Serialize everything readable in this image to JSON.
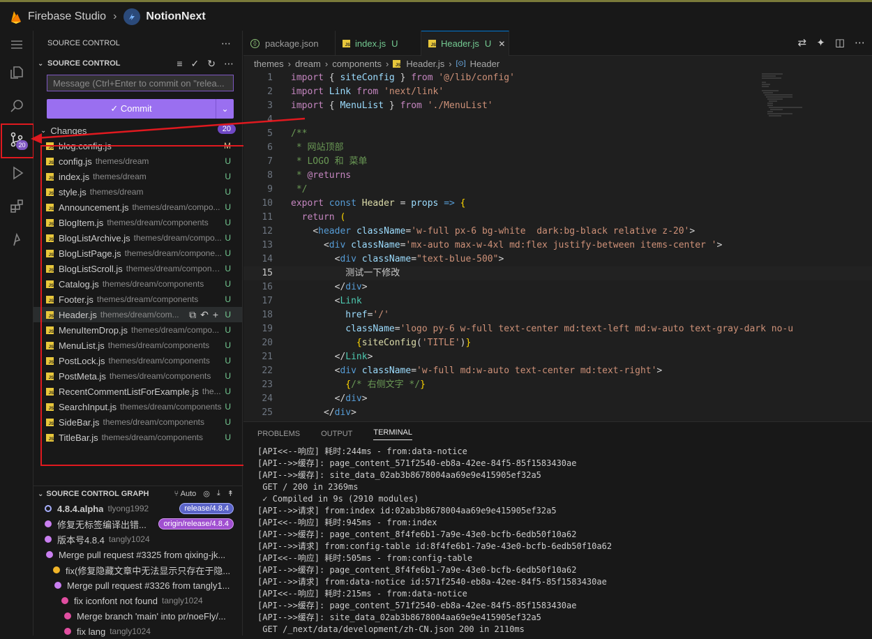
{
  "app": {
    "name": "Firebase Studio",
    "project": "NotionNext"
  },
  "sidebar": {
    "title": "SOURCE CONTROL",
    "section": "SOURCE CONTROL",
    "commit_placeholder": "Message (Ctrl+Enter to commit on \"relea...",
    "commit_label": "Commit",
    "changes_label": "Changes",
    "changes_count": "20",
    "badge_count": "20",
    "files": [
      {
        "name": "blog.config.js",
        "path": "",
        "status": "M"
      },
      {
        "name": "config.js",
        "path": "themes/dream",
        "status": "U"
      },
      {
        "name": "index.js",
        "path": "themes/dream",
        "status": "U"
      },
      {
        "name": "style.js",
        "path": "themes/dream",
        "status": "U"
      },
      {
        "name": "Announcement.js",
        "path": "themes/dream/compo...",
        "status": "U"
      },
      {
        "name": "BlogItem.js",
        "path": "themes/dream/components",
        "status": "U"
      },
      {
        "name": "BlogListArchive.js",
        "path": "themes/dream/compo...",
        "status": "U"
      },
      {
        "name": "BlogListPage.js",
        "path": "themes/dream/compone...",
        "status": "U"
      },
      {
        "name": "BlogListScroll.js",
        "path": "themes/dream/compone...",
        "status": "U"
      },
      {
        "name": "Catalog.js",
        "path": "themes/dream/components",
        "status": "U"
      },
      {
        "name": "Footer.js",
        "path": "themes/dream/components",
        "status": "U"
      },
      {
        "name": "Header.js",
        "path": "themes/dream/com...",
        "status": "U"
      },
      {
        "name": "MenuItemDrop.js",
        "path": "themes/dream/compo...",
        "status": "U"
      },
      {
        "name": "MenuList.js",
        "path": "themes/dream/components",
        "status": "U"
      },
      {
        "name": "PostLock.js",
        "path": "themes/dream/components",
        "status": "U"
      },
      {
        "name": "PostMeta.js",
        "path": "themes/dream/components",
        "status": "U"
      },
      {
        "name": "RecentCommentListForExample.js",
        "path": "the...",
        "status": "U"
      },
      {
        "name": "SearchInput.js",
        "path": "themes/dream/components",
        "status": "U"
      },
      {
        "name": "SideBar.js",
        "path": "themes/dream/components",
        "status": "U"
      },
      {
        "name": "TitleBar.js",
        "path": "themes/dream/components",
        "status": "U"
      }
    ],
    "graph_title": "SOURCE CONTROL GRAPH",
    "graph_auto": "Auto",
    "graph": [
      {
        "msg": "4.8.4.alpha",
        "author": "tlyong1992",
        "badge": "release/4.8.4"
      },
      {
        "msg": "修复无标签编译出错...",
        "author": "",
        "badge": "origin/release/4.8.4"
      },
      {
        "msg": "版本号4.8.4",
        "author": "tangly1024",
        "badge": ""
      },
      {
        "msg": "Merge pull request #3325 from qixing-jk...",
        "author": "",
        "badge": ""
      },
      {
        "msg": "fix(修复隐藏文章中无法显示只存在于隐...",
        "author": "",
        "badge": ""
      },
      {
        "msg": "Merge pull request #3326 from tangly1...",
        "author": "",
        "badge": ""
      },
      {
        "msg": "fix iconfont not found",
        "author": "tangly1024",
        "badge": ""
      },
      {
        "msg": "Merge branch 'main' into pr/noeFly/...",
        "author": "",
        "badge": ""
      },
      {
        "msg": "fix lang",
        "author": "tangly1024",
        "badge": ""
      }
    ]
  },
  "editor": {
    "tabs": [
      {
        "label": "package.json",
        "status": ""
      },
      {
        "label": "index.js",
        "status": "U"
      },
      {
        "label": "Header.js",
        "status": "U"
      }
    ],
    "breadcrumb": [
      "themes",
      "dream",
      "components",
      "Header.js",
      "Header"
    ],
    "current_line": 15
  },
  "panel": {
    "tabs": [
      "PROBLEMS",
      "OUTPUT",
      "TERMINAL"
    ],
    "terminal": [
      "[API<<--响应] 耗时:244ms - from:data-notice",
      "[API-->>缓存]: page_content_571f2540-eb8a-42ee-84f5-85f1583430ae",
      "[API-->>缓存]: site_data_02ab3b8678004aa69e9e415905ef32a5",
      " GET / 200 in 2369ms",
      " ✓ Compiled in 9s (2910 modules)",
      "[API-->>请求] from:index id:02ab3b8678004aa69e9e415905ef32a5",
      "[API<<--响应] 耗时:945ms - from:index",
      "[API-->>缓存]: page_content_8f4fe6b1-7a9e-43e0-bcfb-6edb50f10a62",
      "[API-->>请求] from:config-table id:8f4fe6b1-7a9e-43e0-bcfb-6edb50f10a62",
      "[API<<--响应] 耗时:505ms - from:config-table",
      "[API-->>缓存]: page_content_8f4fe6b1-7a9e-43e0-bcfb-6edb50f10a62",
      "[API-->>请求] from:data-notice id:571f2540-eb8a-42ee-84f5-85f1583430ae",
      "[API<<--响应] 耗时:215ms - from:data-notice",
      "[API-->>缓存]: page_content_571f2540-eb8a-42ee-84f5-85f1583430ae",
      "[API-->>缓存]: site_data_02ab3b8678004aa69e9e415905ef32a5",
      " GET /_next/data/development/zh-CN.json 200 in 2110ms"
    ]
  },
  "colors": {
    "accent": "#9a6ff0",
    "added": "#73c991",
    "modified": "#e2c08d",
    "annotation": "#e0191f"
  }
}
